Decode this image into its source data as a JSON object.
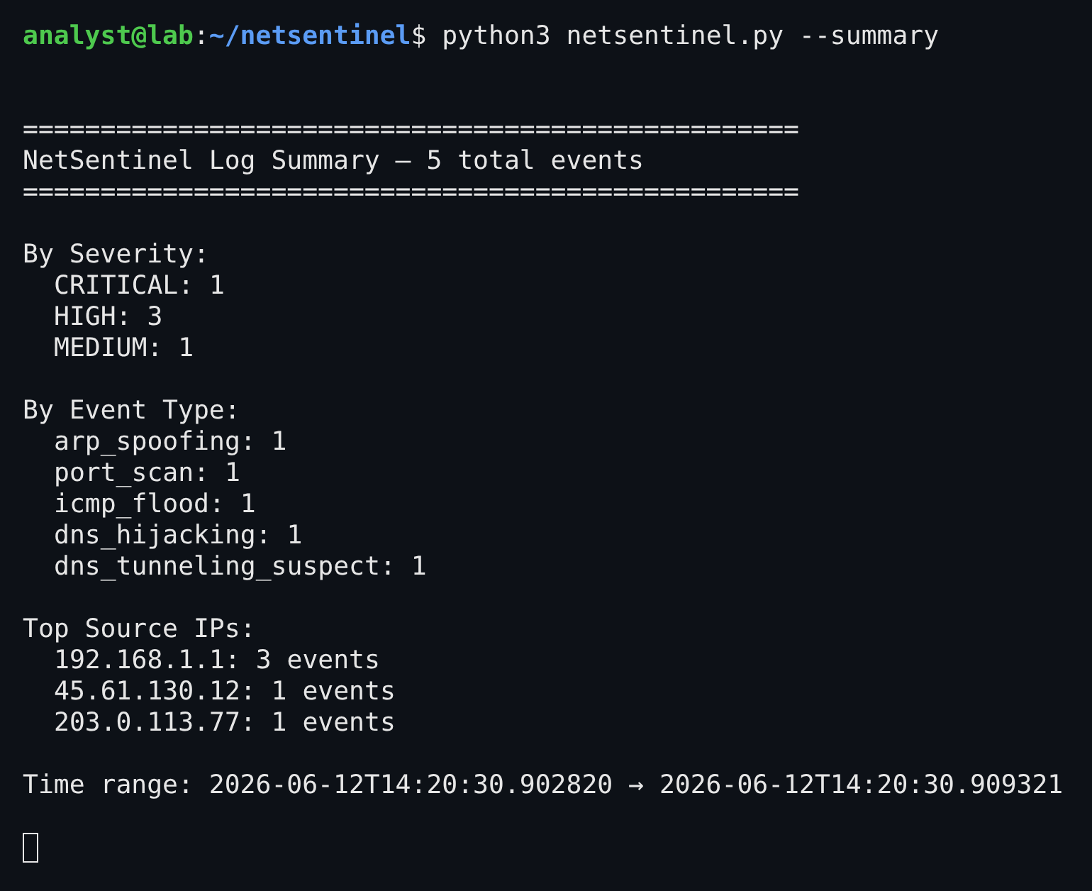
{
  "prompt": {
    "user_host": "analyst@lab",
    "separator": ":",
    "path": "~/netsentinel",
    "symbol": "$",
    "command": "python3 netsentinel.py --summary"
  },
  "rule_top": "==================================================",
  "title": "NetSentinel Log Summary — 5 total events",
  "rule_bottom": "==================================================",
  "sections": [
    {
      "heading": "By Severity:",
      "items": [
        "CRITICAL: 1",
        "HIGH: 3",
        "MEDIUM: 1"
      ]
    },
    {
      "heading": "By Event Type:",
      "items": [
        "arp_spoofing: 1",
        "port_scan: 1",
        "icmp_flood: 1",
        "dns_hijacking: 1",
        "dns_tunneling_suspect: 1"
      ]
    },
    {
      "heading": "Top Source IPs:",
      "items": [
        "192.168.1.1: 3 events",
        "45.61.130.12: 1 events",
        "203.0.113.77: 1 events"
      ]
    }
  ],
  "time_range": "Time range: 2026-06-12T14:20:30.902820 → 2026-06-12T14:20:30.909321"
}
